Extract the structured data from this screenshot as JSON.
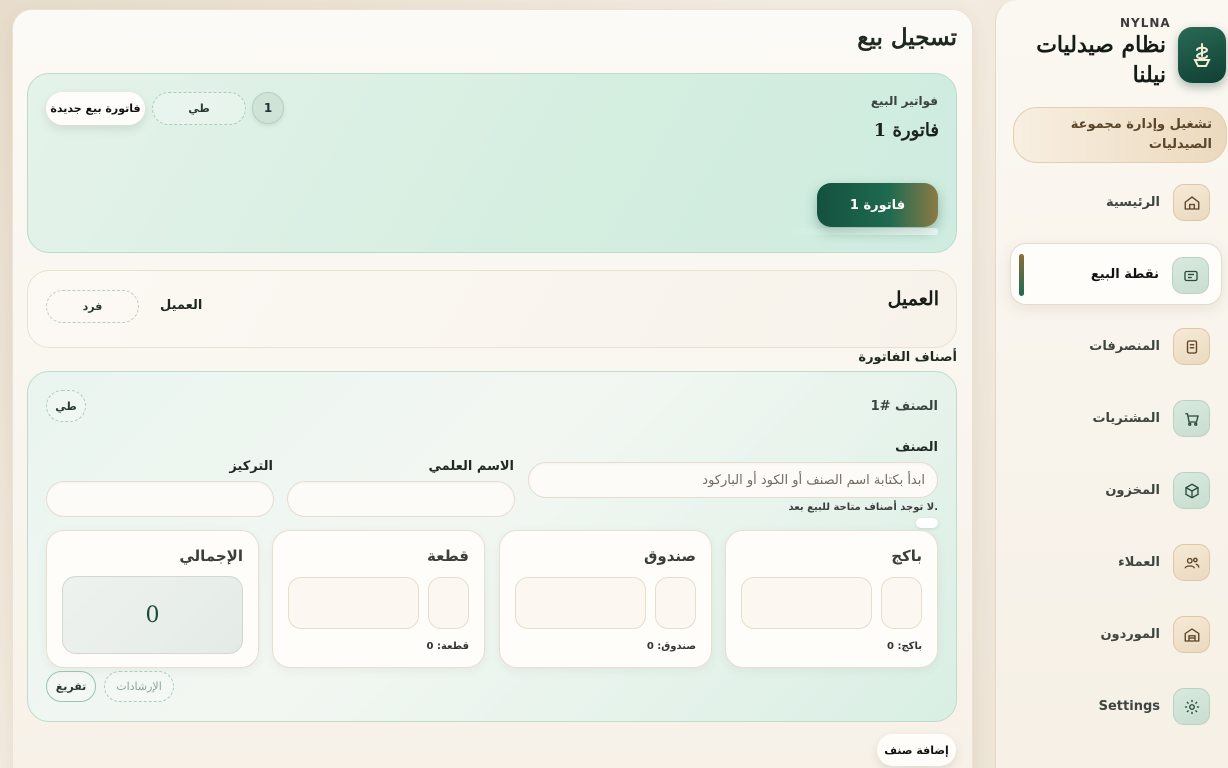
{
  "brand": {
    "short_name": "NYLNA",
    "title": "نظام صيدليات نيلنا",
    "tagline": "تشغيل وإدارة مجموعة الصيدليات"
  },
  "sidebar": {
    "items": [
      {
        "label": "الرئيسية",
        "icon": "home-icon",
        "active": false
      },
      {
        "label": "نقطة البيع",
        "icon": "receipt-icon",
        "active": true
      },
      {
        "label": "المنصرفات",
        "icon": "document-icon",
        "active": false
      },
      {
        "label": "المشتريات",
        "icon": "cart-icon",
        "active": false
      },
      {
        "label": "المخزون",
        "icon": "box-icon",
        "active": false
      },
      {
        "label": "العملاء",
        "icon": "users-icon",
        "active": false
      },
      {
        "label": "الموردون",
        "icon": "warehouse-icon",
        "active": false
      },
      {
        "label": "Settings",
        "icon": "gear-icon",
        "active": false
      }
    ]
  },
  "page": {
    "title": "تسجيل بيع"
  },
  "invoices": {
    "section_label": "فواتير البيع",
    "current_title": "فاتورة 1",
    "new_invoice_button": "فاتورة بيع جديدة",
    "fold_button": "طي",
    "count": "1",
    "tabs": [
      {
        "label": "فاتورة 1",
        "active": true
      }
    ]
  },
  "customer": {
    "title": "العميل",
    "field_label": "العميل",
    "value": "فرد"
  },
  "items_section": {
    "title": "أصناف الفاتورة",
    "add_button": "إضافة صنف"
  },
  "item": {
    "title": "الصنف #1",
    "fold_button": "طي",
    "item_label": "الصنف",
    "item_placeholder": "ابدأ بكتابة اسم الصنف أو الكود أو الباركود",
    "no_items_text": "لا توجد أصناف متاحة للبيع بعد.",
    "scientific_label": "الاسم العلمي",
    "scientific_value": "",
    "concentration_label": "التركيز",
    "concentration_value": "",
    "units": [
      {
        "title": "باكج",
        "footer": "باكج: 0"
      },
      {
        "title": "صندوق",
        "footer": "صندوق: 0"
      },
      {
        "title": "قطعة",
        "footer": "قطعة: 0"
      }
    ],
    "total_label": "الإجمالي",
    "total_value": "0",
    "guidance_button": "الإرشادات",
    "clear_button": "تفريغ"
  },
  "colors": {
    "accent_green": "#14513f",
    "accent_gold": "#8c7a46",
    "card_green": "#d4eee0",
    "cream": "#f7f1e8"
  }
}
